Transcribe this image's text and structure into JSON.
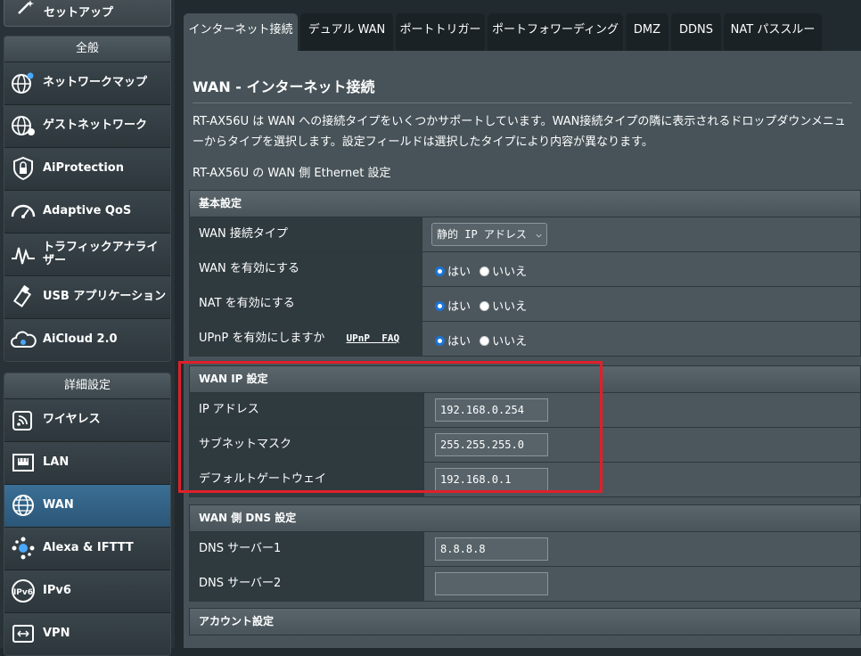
{
  "sidebar": {
    "top_item": {
      "label": "セットアップ",
      "icon": "wand-icon"
    },
    "general": {
      "header": "全般",
      "items": [
        {
          "label": "ネットワークマップ",
          "icon": "globe-map-icon"
        },
        {
          "label": "ゲストネットワーク",
          "icon": "guest-globe-icon"
        },
        {
          "label": "AiProtection",
          "icon": "lock-shield-icon"
        },
        {
          "label": "Adaptive QoS",
          "icon": "speedometer-icon"
        },
        {
          "label": "トラフィックアナライザー",
          "icon": "traffic-wave-icon"
        },
        {
          "label": "USB アプリケーション",
          "icon": "usb-icon"
        },
        {
          "label": "AiCloud 2.0",
          "icon": "cloud-icon"
        }
      ]
    },
    "advanced": {
      "header": "詳細設定",
      "items": [
        {
          "label": "ワイヤレス",
          "icon": "wifi-icon"
        },
        {
          "label": "LAN",
          "icon": "lan-icon"
        },
        {
          "label": "WAN",
          "icon": "globe-icon",
          "active": true
        },
        {
          "label": "Alexa & IFTTT",
          "icon": "alexa-icon"
        },
        {
          "label": "IPv6",
          "icon": "ipv6-icon"
        },
        {
          "label": "VPN",
          "icon": "vpn-icon"
        }
      ]
    }
  },
  "tabs": [
    {
      "label": "インターネット接続",
      "active": true
    },
    {
      "label": "デュアル WAN"
    },
    {
      "label": "ポートトリガー"
    },
    {
      "label": "ポートフォワーディング"
    },
    {
      "label": "DMZ"
    },
    {
      "label": "DDNS"
    },
    {
      "label": "NAT パススルー"
    }
  ],
  "page": {
    "title": "WAN - インターネット接続",
    "description": "RT-AX56U は WAN への接続タイプをいくつかサポートしています。WAN接続タイプの隣に表示されるドロップダウンメニューからタイプを選択します。設定フィールドは選択したタイプにより内容が異なります。",
    "subnote": "RT-AX56U の WAN 側 Ethernet 設定"
  },
  "basic": {
    "header": "基本設定",
    "wan_type_label": "WAN 接続タイプ",
    "wan_type_value": "静的 IP アドレス",
    "enable_wan_label": "WAN を有効にする",
    "enable_nat_label": "NAT を有効にする",
    "enable_upnp_label": "UPnP を有効にしますか",
    "upnp_faq": "UPnP  FAQ",
    "yes": "はい",
    "no": "いいえ"
  },
  "wan_ip": {
    "header": "WAN IP 設定",
    "ip_label": "IP アドレス",
    "ip_value": "192.168.0.254",
    "mask_label": "サブネットマスク",
    "mask_value": "255.255.255.0",
    "gateway_label": "デフォルトゲートウェイ",
    "gateway_value": "192.168.0.1"
  },
  "dns": {
    "header": "WAN 側 DNS 設定",
    "dns1_label": "DNS サーバー1",
    "dns1_value": "8.8.8.8",
    "dns2_label": "DNS サーバー2",
    "dns2_value": ""
  },
  "account": {
    "header": "アカウント設定"
  },
  "colors": {
    "accent_active": "#2b5677",
    "highlight_border": "#e0202a",
    "radio_selected": "#1a74d8"
  }
}
